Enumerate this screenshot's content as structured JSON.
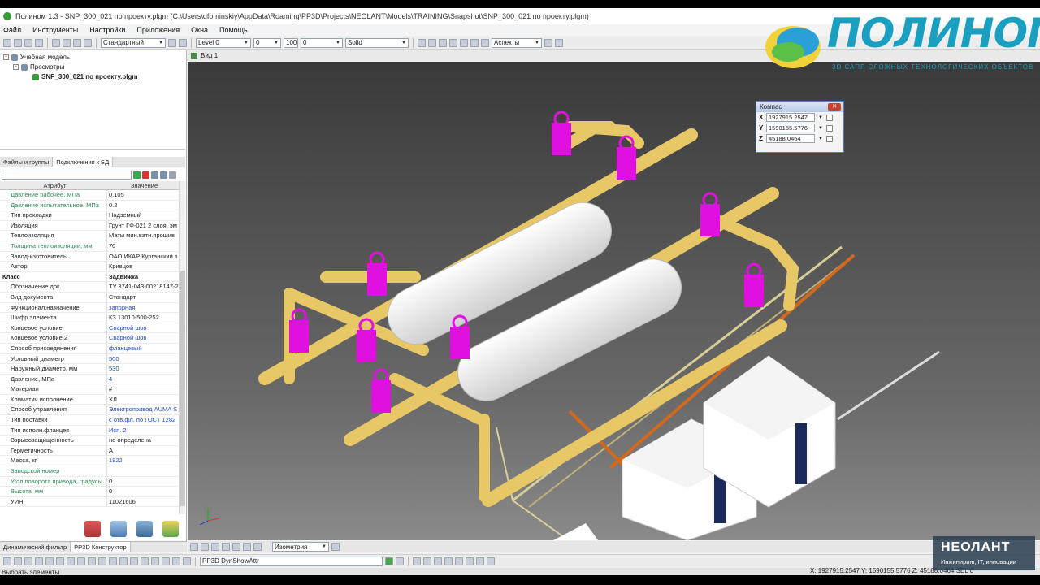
{
  "window": {
    "title": "Полином 1.3 - SNP_300_021 по проекту.plgm (C:\\Users\\dfominskiy\\AppData\\Roaming\\PP3D\\Projects\\NEOLANT\\Models\\TRAINING\\Snapshot\\SNP_300_021 по проекту.plgm)"
  },
  "menu": {
    "items": [
      "Файл",
      "Инструменты",
      "Настройки",
      "Приложения",
      "Окна",
      "Помощь"
    ]
  },
  "toolbar": {
    "style_combo": "Стандартный",
    "level_combo": "Level 0",
    "level_num": "0",
    "zoom_value": "100",
    "line_width": "0",
    "line_style": "Solid",
    "aspects_combo": "Аспекты"
  },
  "tree": {
    "root": "Учебная модель",
    "views": "Просмотры",
    "file": "SNP_300_021 по проекту.plgm"
  },
  "left_tabs": {
    "tab1": "Файлы и группы",
    "tab2": "Подключения к БД"
  },
  "grid": {
    "col_attr": "Атрибут",
    "col_value": "Значение",
    "rows": [
      {
        "a": "Давление рабочее, МПа",
        "v": "0.105"
      },
      {
        "a": "Давление испытательное, МПа",
        "v": "0.2"
      },
      {
        "a": "Тип прокладки",
        "v": "Надземный"
      },
      {
        "a": "Изоляция",
        "v": "Грунт ГФ-021 2 слоя, эм"
      },
      {
        "a": "Теплоизоляция",
        "v": "Маты мин.ватн.прошив"
      },
      {
        "a": "Толщина теплоизоляции, мм",
        "v": "70"
      },
      {
        "a": "Завод-изготовитель",
        "v": "ОАО ИКАР Курганский з"
      },
      {
        "a": "Автор",
        "v": "Кривцов"
      },
      {
        "a": "Класс",
        "v": "Задвижка"
      },
      {
        "a": "Обозначение док.",
        "v": "ТУ 3741-043-00218147-2"
      },
      {
        "a": "Вид документа",
        "v": "Стандарт"
      },
      {
        "a": "Функционал.назначение",
        "v": "запорная"
      },
      {
        "a": "Шифр элемента",
        "v": "КЗ 13010-500-252"
      },
      {
        "a": "Концевое условие",
        "v": "Сварной шов"
      },
      {
        "a": "Концевое условие 2",
        "v": "Сварной шов"
      },
      {
        "a": "Способ присоединения",
        "v": "фланцевый"
      },
      {
        "a": "Условный диаметр",
        "v": "500"
      },
      {
        "a": "Наружный диаметр, мм",
        "v": "530"
      },
      {
        "a": "Давление, МПа",
        "v": "4"
      },
      {
        "a": "Материал",
        "v": "#"
      },
      {
        "a": "Климатич.исполнение",
        "v": "ХЛ"
      },
      {
        "a": "Способ управления",
        "v": "Электропривод AUMA S"
      },
      {
        "a": "Тип поставки",
        "v": "с отв.фл. по ГОСТ 1282"
      },
      {
        "a": "Тип исполн.фланцев",
        "v": "Исп. 2"
      },
      {
        "a": "Взрывозащищенность",
        "v": "не определена"
      },
      {
        "a": "Герметичность",
        "v": "А"
      },
      {
        "a": "Масса, кг",
        "v": "1822"
      },
      {
        "a": "Заводской номер",
        "v": ""
      },
      {
        "a": "Угол поворота привода, градусы",
        "v": "0"
      },
      {
        "a": "Высота, мм",
        "v": "0"
      },
      {
        "a": "УИН",
        "v": "11021606"
      }
    ]
  },
  "bottom_left_tabs": {
    "tab1": "Динамический фильтр",
    "tab2": "PP3D Конструктор"
  },
  "viewport": {
    "title": "Вид 1",
    "projection_combo": "Изометрия"
  },
  "compass": {
    "title": "Компас",
    "x_label": "X",
    "x_value": "1927915.2547",
    "y_label": "Y",
    "y_value": "1590155.5776",
    "z_label": "Z",
    "z_value": "45188.0464"
  },
  "command_line": "PP3D DynShowAttr",
  "status": {
    "text": "Выбрать элементы",
    "coords": "X:  1927915.2547  Y:  1590155.5776  Z:  45188.0464   SEL  0"
  },
  "logo_polinom": {
    "name": "ПОЛИНОМ",
    "tagline": "3D САПР СЛОЖНЫХ ТЕХНОЛОГИЧЕСКИХ ОБЪЕКТОВ"
  },
  "logo_neolant": {
    "name": "НЕОЛАНТ",
    "tagline": "Инжиниринг, IT, инновации"
  },
  "colors": {
    "pipe": "#e8c866",
    "valve": "#e010e0",
    "tank": "#f2f2f2",
    "orange_pipe": "#d2691e",
    "background_top": "#3a3a3a",
    "background_bottom": "#8a8a8a"
  }
}
